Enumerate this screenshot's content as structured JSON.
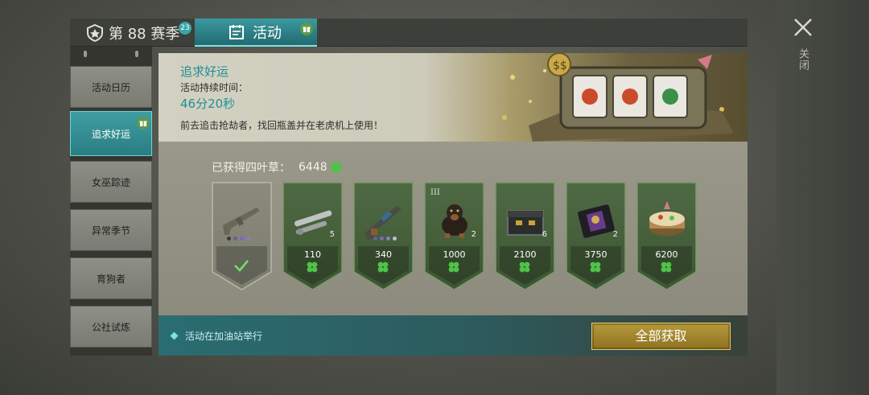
{
  "window": {
    "close_label": "关闭"
  },
  "tabs": {
    "season": {
      "label": "第 88 赛季",
      "badge": "23"
    },
    "activity": {
      "label": "活动"
    }
  },
  "sidebar": {
    "items": [
      {
        "label": "活动日历",
        "active": false
      },
      {
        "label": "追求好运",
        "active": true
      },
      {
        "label": "女巫踪迹",
        "active": false
      },
      {
        "label": "异常季节",
        "active": false
      },
      {
        "label": "育狗者",
        "active": false
      },
      {
        "label": "公社试炼",
        "active": false
      }
    ]
  },
  "event": {
    "title": "追求好运",
    "duration_label": "活动持续时间：",
    "duration_value": "46分20秒",
    "description": "前去追击抢劫者，找回瓶盖并在老虎机上使用！"
  },
  "clovers": {
    "label": "已获得四叶草：",
    "count": "6448"
  },
  "rewards": [
    {
      "name": "rifle",
      "price": "",
      "qty": "",
      "claimed": true,
      "tier": ""
    },
    {
      "name": "pipe-parts",
      "price": "110",
      "qty": "5",
      "claimed": false,
      "tier": ""
    },
    {
      "name": "assault-rifle",
      "price": "340",
      "qty": "",
      "claimed": false,
      "tier": ""
    },
    {
      "name": "dog",
      "price": "1000",
      "qty": "2",
      "claimed": false,
      "tier": "III"
    },
    {
      "name": "crate",
      "price": "2100",
      "qty": "6",
      "claimed": false,
      "tier": ""
    },
    {
      "name": "badge-card",
      "price": "3750",
      "qty": "2",
      "claimed": false,
      "tier": ""
    },
    {
      "name": "cake",
      "price": "6200",
      "qty": "",
      "claimed": false,
      "tier": ""
    }
  ],
  "footer": {
    "note": "活动在加油站举行",
    "claim_all": "全部获取"
  },
  "colors": {
    "accent": "#2a8d93",
    "clover": "#4fc24a",
    "button": "#a8892f"
  }
}
